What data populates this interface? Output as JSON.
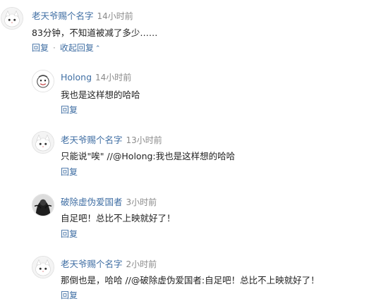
{
  "comments": [
    {
      "author": "老天爷赐个名字",
      "time": "14小时前",
      "text": "83分钟，不知道被减了多少……",
      "reply_label": "回复",
      "collapse_label": "收起回复",
      "collapse_icon": "chevron-up-icon",
      "avatar": "white-cat-avatar"
    },
    {
      "author": "Holong",
      "time": "14小时前",
      "text": "我也是这样想的哈哈",
      "reply_label": "回复",
      "avatar": "cartoon-face-avatar"
    },
    {
      "author": "老天爷赐个名字",
      "time": "13小时前",
      "text": "只能说\"唉\" //@Holong:我也是这样想的哈哈",
      "reply_label": "回复",
      "avatar": "white-cat-avatar"
    },
    {
      "author": "破除虚伪爱国者",
      "time": "3小时前",
      "text": "自足吧！总比不上映就好了！",
      "reply_label": "回复",
      "avatar": "dark-figure-avatar"
    },
    {
      "author": "老天爷赐个名字",
      "time": "2小时前",
      "text": "那倒也是，哈哈 //@破除虚伪爱国者:自足吧！总比不上映就好了！",
      "reply_label": "回复",
      "avatar": "white-cat-avatar"
    }
  ],
  "colors": {
    "link": "#3f6ea3",
    "time": "#8a8a8a",
    "text": "#222222"
  }
}
